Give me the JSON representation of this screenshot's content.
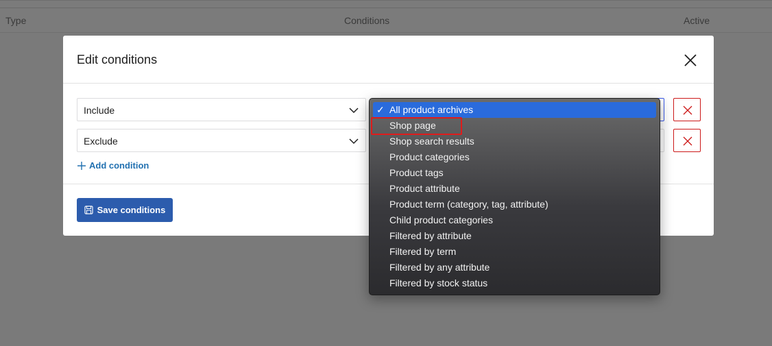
{
  "background_table": {
    "columns": [
      "Type",
      "Conditions",
      "Active"
    ]
  },
  "modal": {
    "title": "Edit conditions",
    "rows": [
      {
        "type": "Include"
      },
      {
        "type": "Exclude"
      }
    ],
    "add_condition_label": "Add condition",
    "save_label": "Save conditions"
  },
  "dropdown": {
    "selected_index": 0,
    "highlighted_index": 1,
    "options": [
      "All product archives",
      "Shop page",
      "Shop search results",
      "Product categories",
      "Product tags",
      "Product attribute",
      "Product term (category, tag, attribute)",
      "Child product categories",
      "Filtered by attribute",
      "Filtered by term",
      "Filtered by any attribute",
      "Filtered by stock status"
    ]
  },
  "colors": {
    "primary": "#2c5cad",
    "link": "#2271b1",
    "danger": "#cc1818",
    "selected_option": "#2a6bdc",
    "annotation_box": "#e01b1b"
  },
  "icons": {
    "close": "close-icon",
    "chevron": "chevron-down-icon",
    "remove": "x-icon",
    "plus": "plus-icon",
    "save": "floppy-disk-icon",
    "check": "checkmark-icon"
  }
}
